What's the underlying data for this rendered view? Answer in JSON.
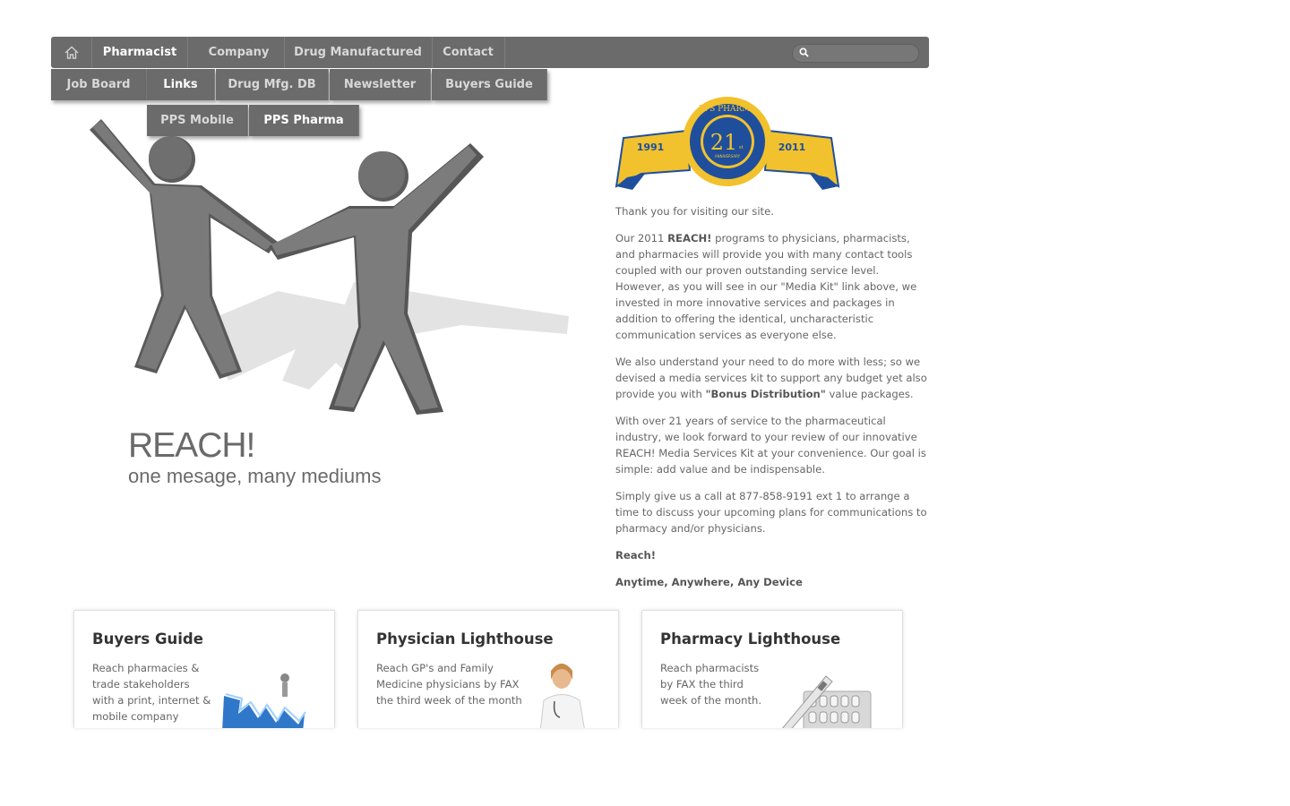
{
  "nav": {
    "items": [
      {
        "label": "Pharmacist",
        "active": true
      },
      {
        "label": "Company",
        "active": false
      },
      {
        "label": "Drug Manufactured",
        "active": false
      },
      {
        "label": "Contact",
        "active": false
      }
    ],
    "search": {
      "placeholder": "",
      "value": ""
    }
  },
  "submenu_level1": [
    {
      "label": "Job Board",
      "active": false
    },
    {
      "label": "Links",
      "active": true
    },
    {
      "label": "Drug Mfg. DB",
      "active": false
    },
    {
      "label": "Newsletter",
      "active": false
    },
    {
      "label": "Buyers Guide",
      "active": false
    }
  ],
  "submenu_level2": [
    {
      "label": "PPS Mobile",
      "active": false
    },
    {
      "label": "PPS Pharma",
      "active": true
    }
  ],
  "hero": {
    "title": "REACH!",
    "subtitle": "one mesage, many mediums"
  },
  "badge": {
    "brand": "PPS PHARMA",
    "number": "21",
    "suffix": "st",
    "ribbon": "ANNIVERSARY",
    "year_left": "1991",
    "year_right": "2011"
  },
  "intro": {
    "p1": "Thank you for visiting our site.",
    "p2_a": "Our 2011 ",
    "p2_b": "REACH!",
    "p2_c": " programs to physicians, pharmacists, and pharmacies will provide you with many contact tools coupled with our proven outstanding service level. However, as you will see in our \"Media Kit\" link above, we invested in more innovative services and packages in addition to offering the identical, uncharacteristic communication services as everyone else.",
    "p3_a": "We also understand your need to do more with less; so we devised a media services kit to support any budget yet also provide you with ",
    "p3_b": "\"Bonus Distribution\"",
    "p3_c": " value packages.",
    "p4": "With over 21 years of service to the pharmaceutical industry, we look forward to your review of our innovative REACH! Media Services Kit at your convenience. Our goal is simple: add value and be indispensable.",
    "p5": "Simply give us a call at 877-858-9191 ext 1 to arrange a time to discuss your upcoming plans for communications to pharmacy and/or physicians.",
    "p6": "Reach!",
    "p7": "Anytime, Anywhere, Any Device"
  },
  "cards": [
    {
      "title": "Buyers Guide",
      "lines": [
        "Reach pharmacies &",
        "trade stakeholders",
        "with a print, internet &",
        "mobile company"
      ]
    },
    {
      "title": "Physician Lighthouse",
      "lines": [
        "Reach GP's and Family",
        "Medicine physicians by FAX",
        "the third week of the month"
      ]
    },
    {
      "title": "Pharmacy Lighthouse",
      "lines": [
        "Reach pharmacists",
        "by FAX the third",
        "week of the month."
      ]
    }
  ],
  "colors": {
    "nav_bg": "#6b6b6b",
    "badge_gold": "#f2c12e",
    "badge_blue": "#1f4f9c"
  }
}
